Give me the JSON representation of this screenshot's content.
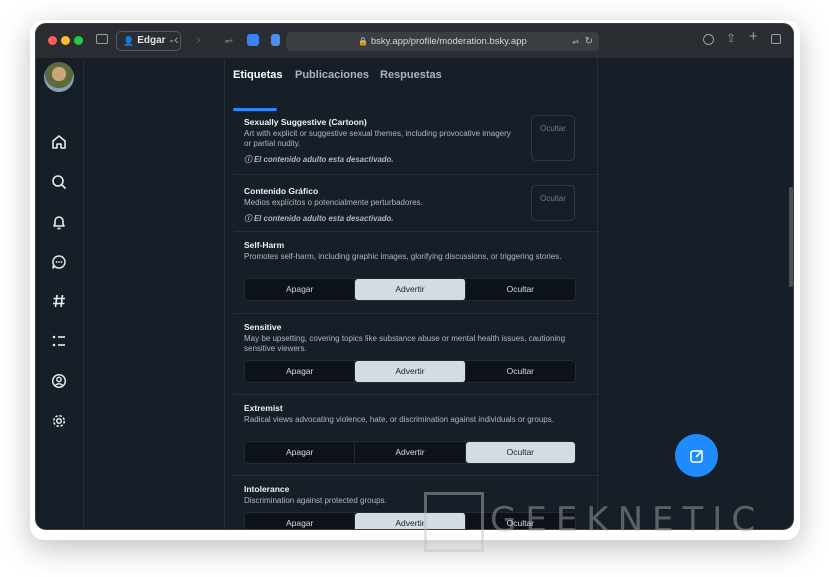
{
  "browser": {
    "profile": "Edgar",
    "url": "bsky.app/profile/moderation.bsky.app"
  },
  "tabs": [
    "Etiquetas",
    "Publicaciones",
    "Respuestas"
  ],
  "sections": [
    {
      "title": "Sexually Suggestive (Cartoon)",
      "desc": "Art with explicit or suggestive sexual themes, including provocative imagery or partial nudity.",
      "note": "El contenido adulto esta desactivado.",
      "button": "Ocultar"
    },
    {
      "title": "Contenido Gráfico",
      "desc": "Medios explícitos o potencialmente perturbadores.",
      "note": "El contenido adulto esta desactivado.",
      "button": "Ocultar"
    },
    {
      "title": "Self-Harm",
      "desc": "Promotes self-harm, including graphic images, glorifying discussions, or triggering stories.",
      "options": [
        "Apagar",
        "Advertir",
        "Ocultar"
      ],
      "selected": "Advertir"
    },
    {
      "title": "Sensitive",
      "desc": "May be upsetting, covering topics like substance abuse or mental health issues, cautioning sensitive viewers.",
      "options": [
        "Apagar",
        "Advertir",
        "Ocultar"
      ],
      "selected": "Advertir"
    },
    {
      "title": "Extremist",
      "desc": "Radical views advocating violence, hate, or discrimination against individuals or groups.",
      "options": [
        "Apagar",
        "Advertir",
        "Ocultar"
      ],
      "selected": "Ocultar"
    },
    {
      "title": "Intolerance",
      "desc": "Discrimination against protected groups.",
      "options": [
        "Apagar",
        "Advertir",
        "Ocultar"
      ],
      "selected": "Advertir"
    }
  ],
  "watermark": "GEEKNETIC",
  "colors": {
    "accent": "#208bfe",
    "background": "#161e27",
    "selected": "#d3dbe3"
  }
}
